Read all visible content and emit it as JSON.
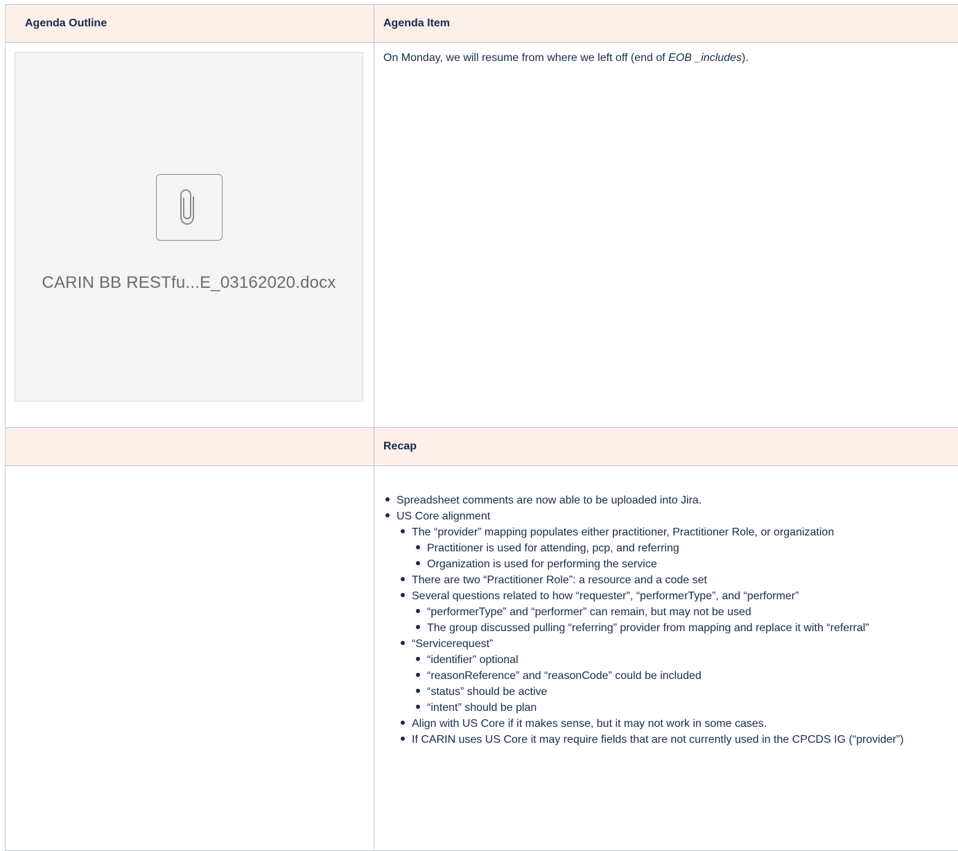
{
  "table": {
    "header": {
      "col1": "Agenda Outline",
      "col2": "Agenda Item"
    },
    "attachment": {
      "filename": "CARIN BB RESTfu...E_03162020.docx",
      "icon": "paperclip-icon"
    },
    "agenda_item": {
      "prefix": "On Monday, we will resume from where we left off (end of ",
      "emphasis": "EOB _includes",
      "suffix": ")."
    },
    "recap_header": {
      "col1": "",
      "col2": "Recap"
    },
    "recap": {
      "items": [
        "Spreadsheet comments are now able to be uploaded into Jira.",
        "US Core alignment",
        "The “provider” mapping populates either practitioner, Practitioner Role, or organization",
        "Practitioner is used for attending, pcp, and referring",
        "Organization is used for performing the service",
        "There are two “Practitioner Role”: a resource and a code set",
        "Several questions related to how “requester”, “performerType”, and “performer”",
        "“performerType” and “performer” can remain, but may not be used",
        "The group discussed pulling “referring” provider from mapping and replace it with “referral”",
        "“Servicerequest”",
        "“identifier” optional",
        "“reasonReference” and “reasonCode” could be included",
        "“status” should be active",
        "“intent” should be plan",
        "Align with US Core if it makes sense, but it may not work in some cases.",
        "If CARIN uses US Core it may require fields that are not currently used in the CPCDS IG (“provider”)"
      ]
    }
  },
  "colors": {
    "header_bg": "#fdefe9",
    "border": "#c1c7d0",
    "text": "#172b4d"
  }
}
